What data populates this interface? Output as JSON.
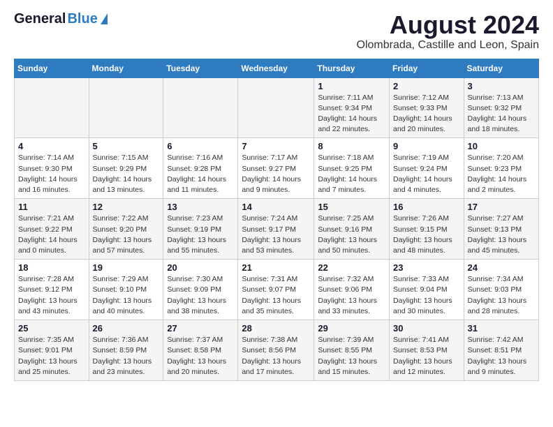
{
  "header": {
    "logo_general": "General",
    "logo_blue": "Blue",
    "title": "August 2024",
    "subtitle": "Olombrada, Castille and Leon, Spain"
  },
  "weekdays": [
    "Sunday",
    "Monday",
    "Tuesday",
    "Wednesday",
    "Thursday",
    "Friday",
    "Saturday"
  ],
  "weeks": [
    [
      {
        "day": "",
        "info": ""
      },
      {
        "day": "",
        "info": ""
      },
      {
        "day": "",
        "info": ""
      },
      {
        "day": "",
        "info": ""
      },
      {
        "day": "1",
        "info": "Sunrise: 7:11 AM\nSunset: 9:34 PM\nDaylight: 14 hours and 22 minutes."
      },
      {
        "day": "2",
        "info": "Sunrise: 7:12 AM\nSunset: 9:33 PM\nDaylight: 14 hours and 20 minutes."
      },
      {
        "day": "3",
        "info": "Sunrise: 7:13 AM\nSunset: 9:32 PM\nDaylight: 14 hours and 18 minutes."
      }
    ],
    [
      {
        "day": "4",
        "info": "Sunrise: 7:14 AM\nSunset: 9:30 PM\nDaylight: 14 hours and 16 minutes."
      },
      {
        "day": "5",
        "info": "Sunrise: 7:15 AM\nSunset: 9:29 PM\nDaylight: 14 hours and 13 minutes."
      },
      {
        "day": "6",
        "info": "Sunrise: 7:16 AM\nSunset: 9:28 PM\nDaylight: 14 hours and 11 minutes."
      },
      {
        "day": "7",
        "info": "Sunrise: 7:17 AM\nSunset: 9:27 PM\nDaylight: 14 hours and 9 minutes."
      },
      {
        "day": "8",
        "info": "Sunrise: 7:18 AM\nSunset: 9:25 PM\nDaylight: 14 hours and 7 minutes."
      },
      {
        "day": "9",
        "info": "Sunrise: 7:19 AM\nSunset: 9:24 PM\nDaylight: 14 hours and 4 minutes."
      },
      {
        "day": "10",
        "info": "Sunrise: 7:20 AM\nSunset: 9:23 PM\nDaylight: 14 hours and 2 minutes."
      }
    ],
    [
      {
        "day": "11",
        "info": "Sunrise: 7:21 AM\nSunset: 9:22 PM\nDaylight: 14 hours and 0 minutes."
      },
      {
        "day": "12",
        "info": "Sunrise: 7:22 AM\nSunset: 9:20 PM\nDaylight: 13 hours and 57 minutes."
      },
      {
        "day": "13",
        "info": "Sunrise: 7:23 AM\nSunset: 9:19 PM\nDaylight: 13 hours and 55 minutes."
      },
      {
        "day": "14",
        "info": "Sunrise: 7:24 AM\nSunset: 9:17 PM\nDaylight: 13 hours and 53 minutes."
      },
      {
        "day": "15",
        "info": "Sunrise: 7:25 AM\nSunset: 9:16 PM\nDaylight: 13 hours and 50 minutes."
      },
      {
        "day": "16",
        "info": "Sunrise: 7:26 AM\nSunset: 9:15 PM\nDaylight: 13 hours and 48 minutes."
      },
      {
        "day": "17",
        "info": "Sunrise: 7:27 AM\nSunset: 9:13 PM\nDaylight: 13 hours and 45 minutes."
      }
    ],
    [
      {
        "day": "18",
        "info": "Sunrise: 7:28 AM\nSunset: 9:12 PM\nDaylight: 13 hours and 43 minutes."
      },
      {
        "day": "19",
        "info": "Sunrise: 7:29 AM\nSunset: 9:10 PM\nDaylight: 13 hours and 40 minutes."
      },
      {
        "day": "20",
        "info": "Sunrise: 7:30 AM\nSunset: 9:09 PM\nDaylight: 13 hours and 38 minutes."
      },
      {
        "day": "21",
        "info": "Sunrise: 7:31 AM\nSunset: 9:07 PM\nDaylight: 13 hours and 35 minutes."
      },
      {
        "day": "22",
        "info": "Sunrise: 7:32 AM\nSunset: 9:06 PM\nDaylight: 13 hours and 33 minutes."
      },
      {
        "day": "23",
        "info": "Sunrise: 7:33 AM\nSunset: 9:04 PM\nDaylight: 13 hours and 30 minutes."
      },
      {
        "day": "24",
        "info": "Sunrise: 7:34 AM\nSunset: 9:03 PM\nDaylight: 13 hours and 28 minutes."
      }
    ],
    [
      {
        "day": "25",
        "info": "Sunrise: 7:35 AM\nSunset: 9:01 PM\nDaylight: 13 hours and 25 minutes."
      },
      {
        "day": "26",
        "info": "Sunrise: 7:36 AM\nSunset: 8:59 PM\nDaylight: 13 hours and 23 minutes."
      },
      {
        "day": "27",
        "info": "Sunrise: 7:37 AM\nSunset: 8:58 PM\nDaylight: 13 hours and 20 minutes."
      },
      {
        "day": "28",
        "info": "Sunrise: 7:38 AM\nSunset: 8:56 PM\nDaylight: 13 hours and 17 minutes."
      },
      {
        "day": "29",
        "info": "Sunrise: 7:39 AM\nSunset: 8:55 PM\nDaylight: 13 hours and 15 minutes."
      },
      {
        "day": "30",
        "info": "Sunrise: 7:41 AM\nSunset: 8:53 PM\nDaylight: 13 hours and 12 minutes."
      },
      {
        "day": "31",
        "info": "Sunrise: 7:42 AM\nSunset: 8:51 PM\nDaylight: 13 hours and 9 minutes."
      }
    ]
  ]
}
